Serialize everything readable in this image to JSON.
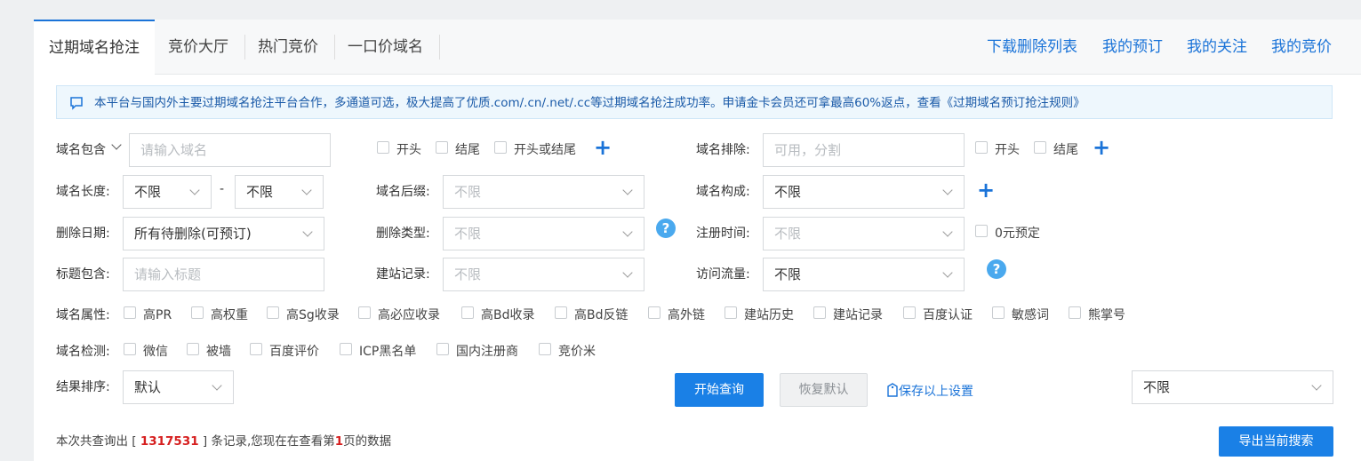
{
  "tabs": [
    {
      "label": "过期域名抢注",
      "active": true
    },
    {
      "label": "竞价大厅"
    },
    {
      "label": "热门竞价"
    },
    {
      "label": "一口价域名"
    }
  ],
  "right_links": [
    "下载删除列表",
    "我的预订",
    "我的关注",
    "我的竞价"
  ],
  "notice": {
    "icon": "comment-icon",
    "text": "本平台与国内外主要过期域名抢注平台合作，多通道可选，极大提高了优质.com/.cn/.net/.cc等过期域名抢注成功率。申请金卡会员还可拿最高60%返点，查看《过期域名预订抢注规则》"
  },
  "form": {
    "domain_contains": {
      "label": "域名包含",
      "placeholder": "请输入域名",
      "opts": [
        "开头",
        "结尾",
        "开头或结尾"
      ]
    },
    "domain_exclude": {
      "label": "域名排除:",
      "placeholder": "可用，分割",
      "opts": [
        "开头",
        "结尾"
      ]
    },
    "length": {
      "label": "域名长度:",
      "min": "不限",
      "dash": "-",
      "max": "不限"
    },
    "suffix": {
      "label": "域名后缀:",
      "value": "不限"
    },
    "composition": {
      "label": "域名构成:",
      "value": "不限"
    },
    "delete_date": {
      "label": "删除日期:",
      "value": "所有待删除(可预订)"
    },
    "delete_type": {
      "label": "删除类型:",
      "value": "不限"
    },
    "reg_time": {
      "label": "注册时间:",
      "value": "不限",
      "zero_label": "0元预定"
    },
    "title": {
      "label": "标题包含:",
      "placeholder": "请输入标题"
    },
    "site_record": {
      "label": "建站记录:",
      "value": "不限"
    },
    "traffic": {
      "label": "访问流量:",
      "value": "不限"
    },
    "attributes": {
      "label": "域名属性:",
      "items": [
        "高PR",
        "高权重",
        "高Sg收录",
        "高必应收录",
        "高Bd收录",
        "高Bd反链",
        "高外链",
        "建站历史",
        "建站记录",
        "百度认证",
        "敏感词",
        "熊掌号"
      ]
    },
    "detection": {
      "label": "域名检测:",
      "items": [
        "微信",
        "被墙",
        "百度评价",
        "ICP黑名单",
        "国内注册商",
        "竞价米"
      ]
    },
    "sort": {
      "label": "结果排序:",
      "value": "默认"
    },
    "right_select": "不限"
  },
  "buttons": {
    "search": "开始查询",
    "reset": "恢复默认",
    "save": "保存以上设置",
    "export": "导出当前搜索"
  },
  "summary": {
    "pre": "本次共查询出 [ ",
    "count": "1317531",
    "mid": " ] 条记录,您现在在查看第",
    "page": "1",
    "post": "页的数据"
  },
  "colors": {
    "accent": "#1a73d8",
    "highlight": "#d61f1f"
  }
}
